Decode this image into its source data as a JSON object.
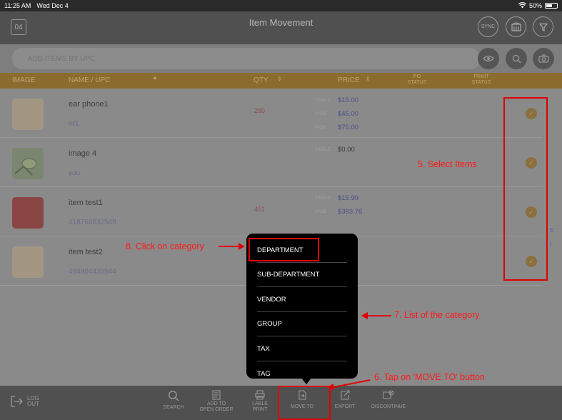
{
  "status": {
    "time": "11:25 AM",
    "date": "Wed Dec 4",
    "battery": "50%",
    "battery_level": 0.5
  },
  "header": {
    "title": "Item Movement",
    "date_badge": "04",
    "sync_label": "SYNC"
  },
  "search": {
    "placeholder": "ADD ITEMS BY UPC"
  },
  "columns": {
    "image": "IMAGE",
    "name_upc": "NAME / UPC",
    "qty": "QTY",
    "price": "PRICE",
    "po_status_1": "PO",
    "po_status_2": "STATUS",
    "print_status_1": "PRINT",
    "print_status_2": "STATUS"
  },
  "items": [
    {
      "name": "ear phone1",
      "upc": "er1",
      "qty": "280",
      "prices": [
        {
          "label": "SINGLE",
          "value": "$15.00"
        },
        {
          "label": "CASE",
          "value": "$45.00"
        },
        {
          "label": "PACK",
          "value": "$75.00"
        }
      ]
    },
    {
      "name": "image 4",
      "upc": "you",
      "qty": "",
      "prices": [
        {
          "label": "SINGLE",
          "value": "$0.00"
        }
      ]
    },
    {
      "name": "item test1",
      "upc": "418764632548",
      "qty": "451",
      "prices": [
        {
          "label": "SINGLE",
          "value": "$15.99"
        },
        {
          "label": "CASE",
          "value": "$383.76"
        }
      ]
    },
    {
      "name": "item test2",
      "upc": "484804435544",
      "qty": "",
      "prices": []
    }
  ],
  "side_letters": [
    "E",
    "I"
  ],
  "bottom_bar": {
    "logout_1": "LOG",
    "logout_2": "OUT",
    "search": "SEARCH",
    "add_open_order_1": "ADD TO",
    "add_open_order_2": "OPEN ORDER",
    "label_print_1": "LABLE",
    "label_print_2": "PRINT",
    "move_to": "MOVE TO",
    "export": "EXPORT",
    "discontinue": "DISCONTINUE"
  },
  "popup_menu": [
    "DEPARTMENT",
    "SUB-DEPARTMENT",
    "VENDOR",
    "GROUP",
    "TAX",
    "TAG"
  ],
  "annotations": {
    "select_items": "5. Select Items",
    "tap_move_to": "6. Tap on 'MOVE TO' button",
    "list_category": "7. List of the category",
    "click_category": "8. Click on category"
  },
  "colors": {
    "accent": "#8c6c2e",
    "annotation": "#e00000",
    "price": "#4f4f8a"
  },
  "icons": [
    "wifi-icon",
    "battery-icon",
    "calendar-icon",
    "sync-icon",
    "store-icon",
    "filter-icon",
    "eye-icon",
    "search-icon",
    "camera-icon",
    "check-icon",
    "logout-icon",
    "open-order-icon",
    "print-icon",
    "move-to-icon",
    "export-icon",
    "discontinue-icon"
  ]
}
